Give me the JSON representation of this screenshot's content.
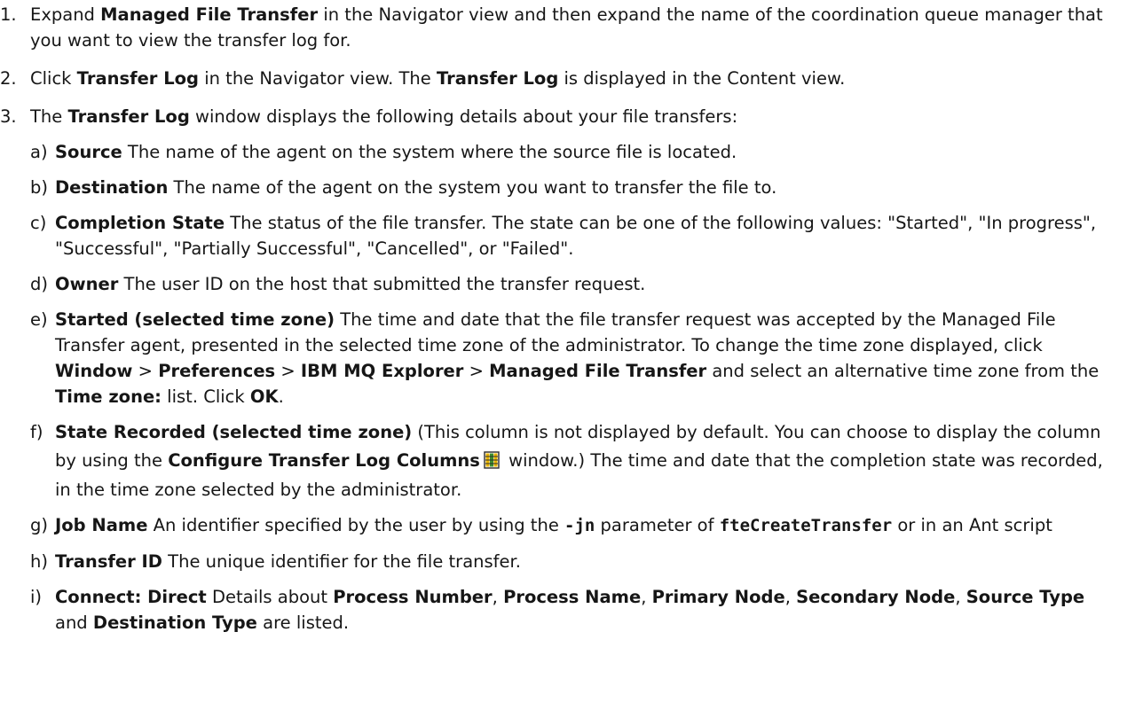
{
  "steps": [
    {
      "num": "1.",
      "parts": [
        "Expand ",
        "Managed File Transfer",
        " in the Navigator view and then expand the name of the coordination queue manager that you want to view the transfer log for."
      ]
    },
    {
      "num": "2.",
      "parts": [
        "Click ",
        "Transfer Log",
        " in the Navigator view. The ",
        "Transfer Log",
        " is displayed in the Content view."
      ]
    },
    {
      "num": "3.",
      "parts": [
        "The ",
        "Transfer Log",
        " window displays the following details about your file transfers:"
      ]
    }
  ],
  "subs": {
    "a": {
      "letter": "a)",
      "term": "Source",
      "text": " The name of the agent on the system where the source file is located."
    },
    "b": {
      "letter": "b)",
      "term": "Destination",
      "text": " The name of the agent on the system you want to transfer the file to."
    },
    "c": {
      "letter": "c)",
      "term": "Completion State",
      "text": " The status of the file transfer. The state can be one of the following values: \"Started\", \"In progress\", \"Successful\", \"Partially Successful\", \"Cancelled\", or \"Failed\"."
    },
    "d": {
      "letter": "d)",
      "term": "Owner",
      "text": " The user ID on the host that submitted the transfer request."
    },
    "e": {
      "letter": "e)",
      "parts": [
        {
          "b": "Started (selected time zone)"
        },
        {
          "t": " The time and date that the file transfer request was accepted by the Managed File Transfer agent, presented in the selected time zone of the administrator. To change the time zone displayed, click "
        },
        {
          "b": "Window"
        },
        {
          "t": " > "
        },
        {
          "b": "Preferences"
        },
        {
          "t": " > "
        },
        {
          "b": "IBM MQ Explorer"
        },
        {
          "t": " > "
        },
        {
          "b": "Managed File Transfer"
        },
        {
          "t": " and select an alternative time zone from the "
        },
        {
          "b": "Time zone:"
        },
        {
          "t": " list. Click "
        },
        {
          "b": "OK"
        },
        {
          "t": "."
        }
      ]
    },
    "f": {
      "letter": "f)",
      "term": "State Recorded (selected time zone)",
      "text1": " (This column is not displayed by default. You can choose to display the column by using the ",
      "term2": "Configure Transfer Log Columns",
      "icon": "configure-columns-icon",
      "text2": " window.) The time and date that the completion state was recorded, in the time zone selected by the administrator."
    },
    "g": {
      "letter": "g)",
      "term": "Job Name",
      "text1": " An identifier specified by the user by using the ",
      "code1": "-jn",
      "text2": " parameter of ",
      "code2": "fteCreateTransfer",
      "text3": " or in an Ant script"
    },
    "h": {
      "letter": "h)",
      "term": "Transfer ID",
      "text": " The unique identifier for the file transfer."
    },
    "i": {
      "letter": "i)",
      "parts": [
        {
          "b": "Connect: Direct"
        },
        {
          "t": " Details about "
        },
        {
          "b": "Process Number"
        },
        {
          "t": ", "
        },
        {
          "b": "Process Name"
        },
        {
          "t": ", "
        },
        {
          "b": "Primary Node"
        },
        {
          "t": ", "
        },
        {
          "b": "Secondary Node"
        },
        {
          "t": ", "
        },
        {
          "b": "Source Type"
        },
        {
          "t": " and "
        },
        {
          "b": "Destination Type"
        },
        {
          "t": " are listed."
        }
      ]
    }
  },
  "colors": {
    "text": "#161616",
    "icon_yellow": "#e8b400",
    "icon_green": "#3c8d2f",
    "icon_dark": "#2b2b2b"
  }
}
